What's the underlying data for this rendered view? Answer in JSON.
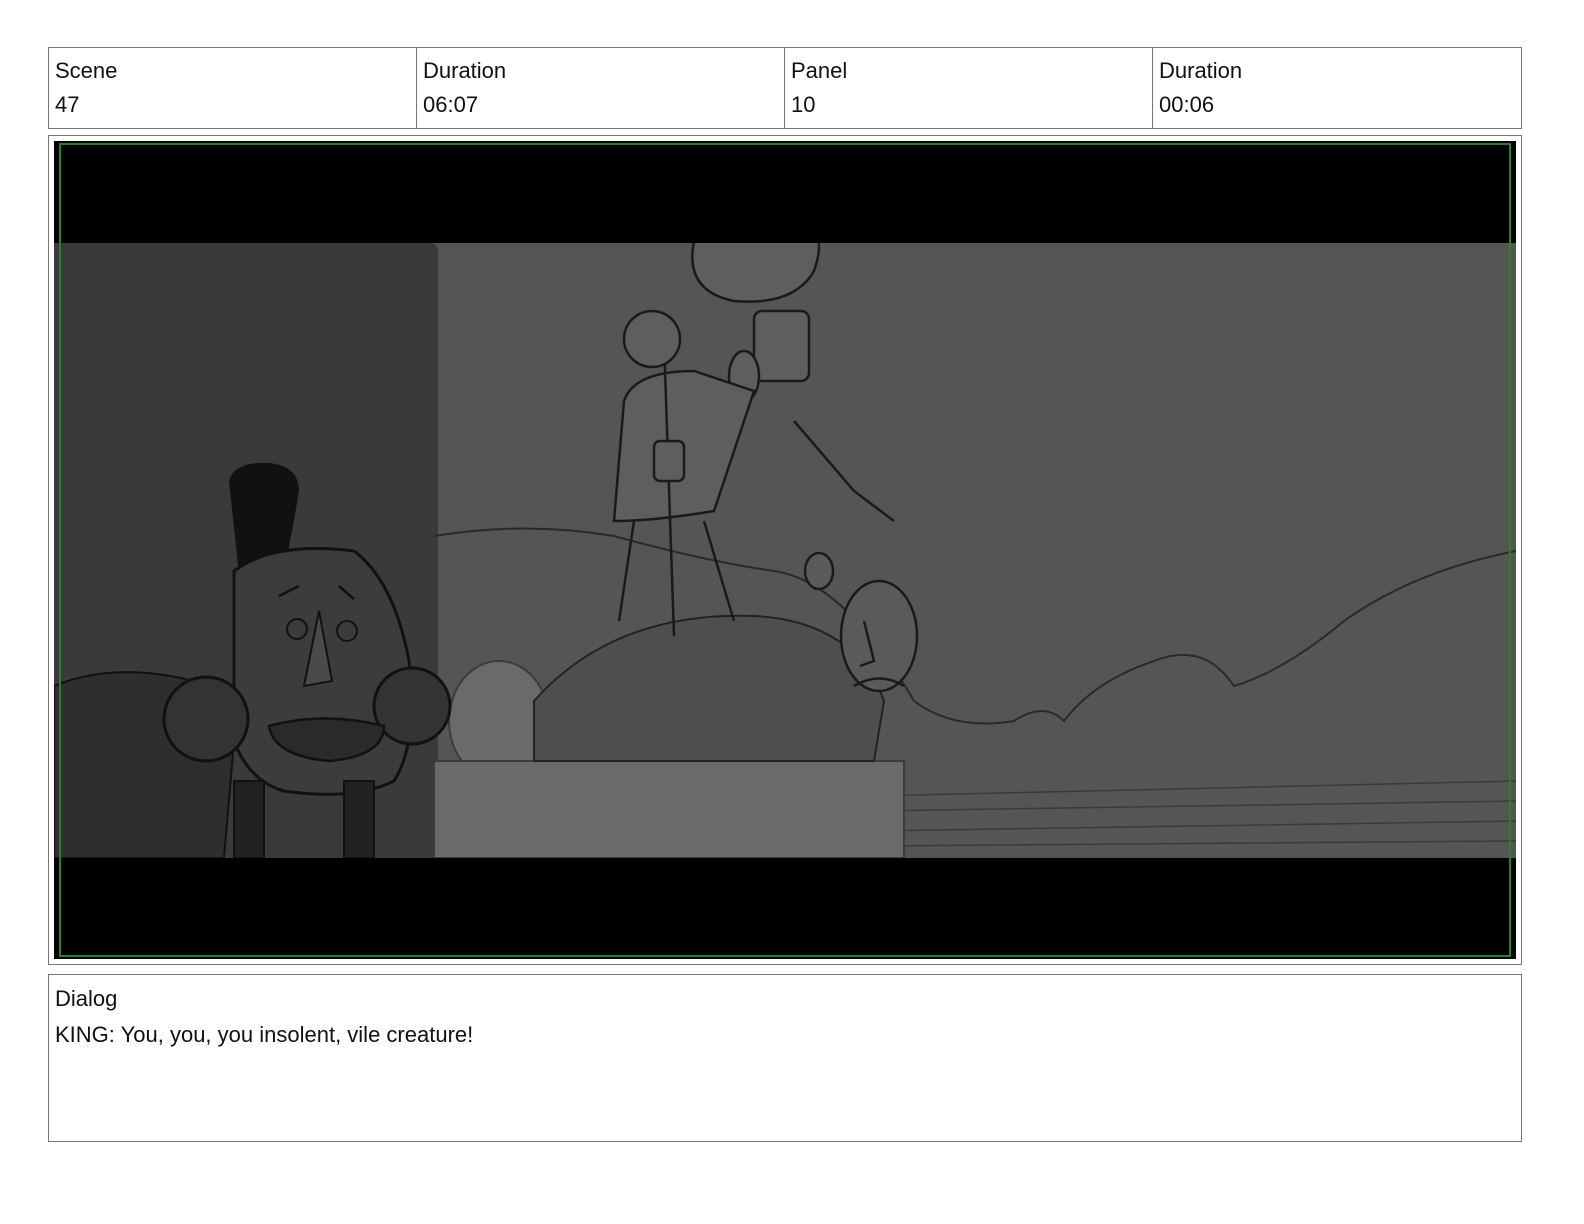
{
  "header": {
    "scene": {
      "label": "Scene",
      "value": "47"
    },
    "scene_duration": {
      "label": "Duration",
      "value": "06:07"
    },
    "panel": {
      "label": "Panel",
      "value": "10"
    },
    "panel_duration": {
      "label": "Duration",
      "value": "00:06"
    }
  },
  "panel_image": {
    "frame_color": "#2e7d32",
    "letterbox_color": "#000000",
    "background_color": "#555555"
  },
  "dialog": {
    "label": "Dialog",
    "text": "KING: You, you, you insolent, vile creature!"
  }
}
